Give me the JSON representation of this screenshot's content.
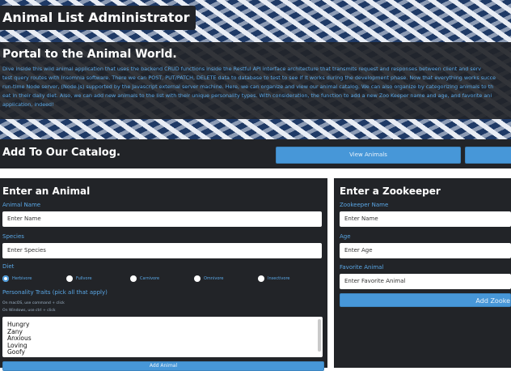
{
  "app": {
    "title": "Animal List Administrator"
  },
  "hero": {
    "heading": "Portal to the Animal World.",
    "paragraph_lines": [
      "Dive inside this wild animal application that uses the backend CRUD functions inside the Restful API interface architecture that transmits request and responses between client and serv",
      "test query routes with Insomnia software. There we can POST, PUT/PATCH, DELETE data to database to test to see if it works during the development phase. Now that everything works succe",
      "run-time Node server, (Node.js) supported by the Javascript external server machine. Here, we can organize and view our animal catalog. We can also organize by categorizing animals to th",
      "eat in their daily diet. Also, we can add new animals to the list with their unique personality types. With consideration, the function to add a new Zoo Keeper name and age, and favorite ani",
      "application, indeed!"
    ]
  },
  "catalog": {
    "title": "Add To Our Catalog.",
    "view_animals_label": "View Animals"
  },
  "animal_form": {
    "heading": "Enter an Animal",
    "name_label": "Animal Name",
    "name_placeholder": "Enter Name",
    "species_label": "Species",
    "species_placeholder": "Enter Species",
    "diet_label": "Diet",
    "diet_options": [
      {
        "label": "Herbivore",
        "selected": true
      },
      {
        "label": "Fullvore",
        "selected": false
      },
      {
        "label": "Carnivore",
        "selected": false
      },
      {
        "label": "Omnivore",
        "selected": false
      },
      {
        "label": "Insectivore",
        "selected": false
      }
    ],
    "traits_label": "Personality Traits (pick all that apply)",
    "mac_hint": "On macOS, use command + click",
    "windows_hint": "On Windows, use ctrl + click",
    "traits": [
      "Hungry",
      "Zany",
      "Anxious",
      "Loving",
      "Goofy"
    ],
    "add_button_label": "Add Animal"
  },
  "keeper_form": {
    "heading": "Enter a Zookeeper",
    "name_label": "Zookeeper Name",
    "name_placeholder": "Enter Name",
    "age_label": "Age",
    "age_placeholder": "Enter Age",
    "favorite_label": "Favorite Animal",
    "favorite_placeholder": "Enter Favorite Animal",
    "add_button_label": "Add Zooke"
  },
  "colors": {
    "panel_bg": "#222428",
    "accent_blue": "#4797d8",
    "label_blue": "#5aa7e6",
    "zebra_dark": "#1f3a66"
  }
}
